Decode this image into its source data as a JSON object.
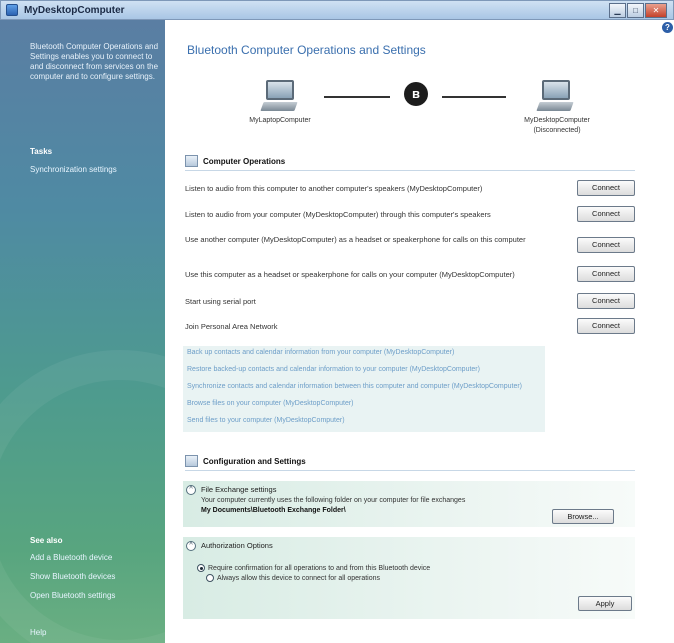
{
  "window": {
    "title": "MyDesktopComputer"
  },
  "sidebar": {
    "intro": "Bluetooth Computer Operations and Settings enables you to connect to and disconnect from services on the computer and to configure settings.",
    "tasks_heading": "Tasks",
    "tasks": [
      "Synchronization settings"
    ],
    "see_also_heading": "See also",
    "see_also": [
      "Add a Bluetooth device",
      "Show Bluetooth devices",
      "Open Bluetooth settings"
    ],
    "help": "Help"
  },
  "main": {
    "title": "Bluetooth Computer Operations and Settings",
    "devices": {
      "local": "MyLaptopComputer",
      "remote": "MyDesktopComputer",
      "remote_status": "(Disconnected)"
    },
    "operations": {
      "heading": "Computer Operations",
      "items": [
        {
          "label": "Listen to audio from this computer to another computer's speakers (MyDesktopComputer)",
          "button": "Connect"
        },
        {
          "label": "Listen to audio from your computer (MyDesktopComputer) through this computer's speakers",
          "button": "Connect"
        },
        {
          "label": "Use another computer (MyDesktopComputer) as a headset or speakerphone for calls on this computer",
          "button": "Connect"
        },
        {
          "label": "Use this computer as a headset or speakerphone for calls on your computer (MyDesktopComputer)",
          "button": "Connect"
        },
        {
          "label": "Start using serial port",
          "button": "Connect"
        },
        {
          "label": "Join Personal Area Network",
          "button": "Connect"
        }
      ],
      "services": [
        "Back up contacts and calendar information from your computer (MyDesktopComputer)",
        "Restore backed-up contacts and calendar information to your computer (MyDesktopComputer)",
        "Synchronize contacts and calendar information between this computer and computer (MyDesktopComputer)",
        "Browse files on your computer (MyDesktopComputer)",
        "Send files to your computer (MyDesktopComputer)"
      ]
    },
    "config": {
      "heading": "Configuration and Settings",
      "file_exchange": {
        "title": "File Exchange settings",
        "description": "Your computer currently uses the following folder on your computer for file exchanges",
        "folder": "My Documents\\Bluetooth Exchange Folder\\",
        "button": "Browse..."
      },
      "authorization": {
        "title": "Authorization Options",
        "options": [
          {
            "label": "Require confirmation for all operations to and from this Bluetooth device",
            "selected": true
          },
          {
            "label": "Always allow this device to connect for all operations",
            "selected": false
          }
        ],
        "apply_button": "Apply"
      }
    }
  }
}
